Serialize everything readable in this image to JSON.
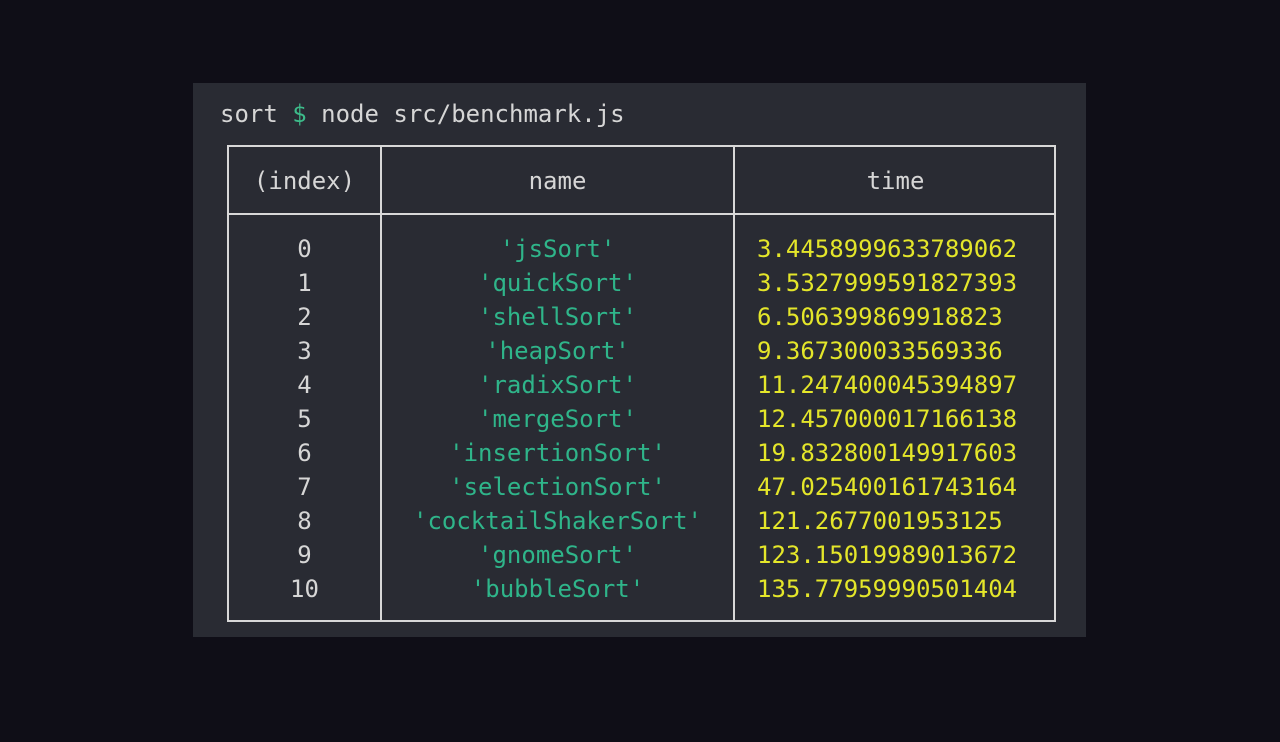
{
  "terminal": {
    "cwd": "sort",
    "prompt_symbol": "$",
    "command": "node src/benchmark.js"
  },
  "table": {
    "headers": {
      "index": "(index)",
      "name": "name",
      "time": "time"
    },
    "rows": [
      {
        "index": "0",
        "name": "'jsSort'",
        "time": "3.4458999633789062"
      },
      {
        "index": "1",
        "name": "'quickSort'",
        "time": "3.5327999591827393"
      },
      {
        "index": "2",
        "name": "'shellSort'",
        "time": "6.506399869918823"
      },
      {
        "index": "3",
        "name": "'heapSort'",
        "time": "9.367300033569336"
      },
      {
        "index": "4",
        "name": "'radixSort'",
        "time": "11.247400045394897"
      },
      {
        "index": "5",
        "name": "'mergeSort'",
        "time": "12.457000017166138"
      },
      {
        "index": "6",
        "name": "'insertionSort'",
        "time": "19.832800149917603"
      },
      {
        "index": "7",
        "name": "'selectionSort'",
        "time": "47.025400161743164"
      },
      {
        "index": "8",
        "name": "'cocktailShakerSort'",
        "time": "121.2677001953125"
      },
      {
        "index": "9",
        "name": "'gnomeSort'",
        "time": "123.15019989013672"
      },
      {
        "index": "10",
        "name": "'bubbleSort'",
        "time": "135.77959990501404"
      }
    ]
  },
  "colors": {
    "page_background": "#0f0e17",
    "terminal_background": "#292b33",
    "text": "#d6d6d6",
    "prompt_symbol": "#3dbb8a",
    "string_value": "#2fb58a",
    "number_value": "#e4e62a",
    "table_border": "#d8d8d8"
  }
}
